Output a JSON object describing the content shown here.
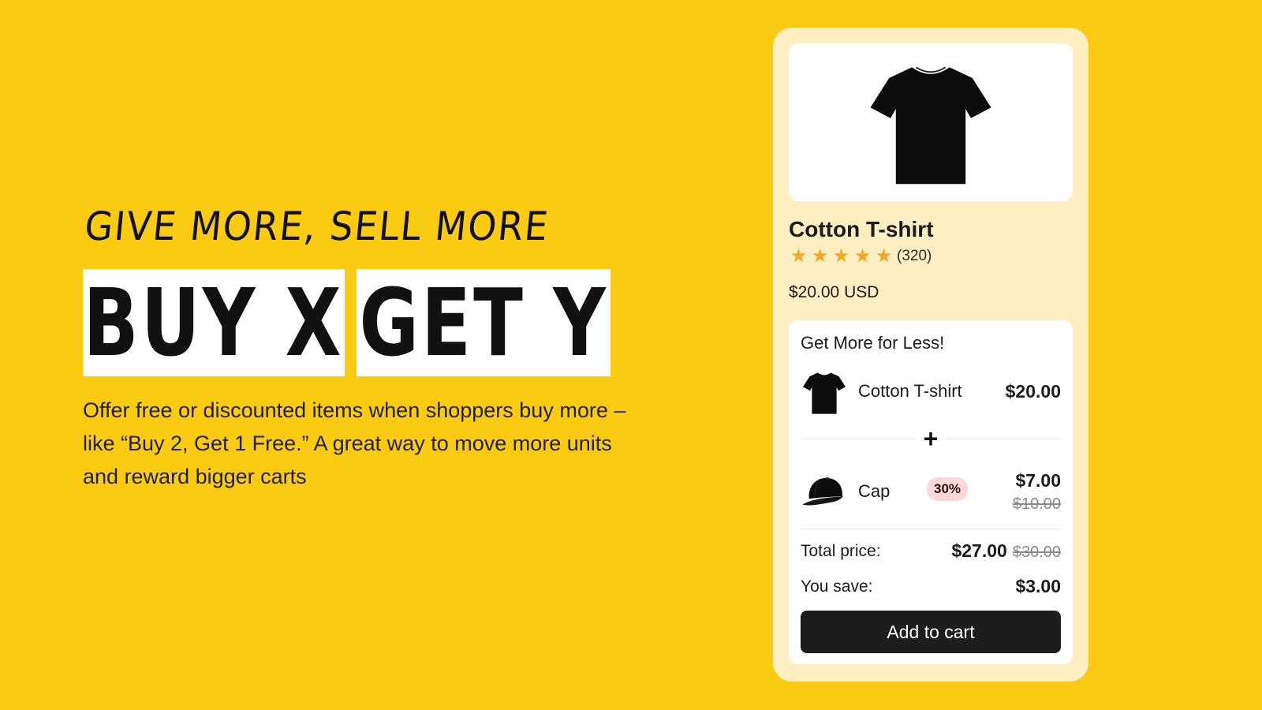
{
  "hero": {
    "tagline": "GIVE MORE, SELL MORE",
    "headline_part1": "BUY X",
    "headline_part2": "GET Y",
    "description": "Offer free or discounted items when shoppers buy more – like “Buy 2, Get 1 Free.” A great way to move more units and reward bigger carts"
  },
  "product": {
    "image_icon": "t-shirt-icon",
    "title": "Cotton T-shirt",
    "rating": 5,
    "review_count": "(320)",
    "price": "$20.00 USD"
  },
  "bundle": {
    "title": "Get More for Less!",
    "items": [
      {
        "icon": "t-shirt-icon",
        "name": "Cotton T-shirt",
        "price": "$20.00"
      },
      {
        "icon": "cap-icon",
        "name": "Cap",
        "discount": "30%",
        "price": "$7.00",
        "original_price": "$10.00"
      }
    ],
    "separator_icon": "plus-icon",
    "total_label": "Total price:",
    "total_price": "$27.00",
    "total_original": "$30.00",
    "save_label": "You save:",
    "save_amount": "$3.00",
    "button_label": "Add to cart"
  },
  "colors": {
    "background": "#FBCB14",
    "card": "#FDEFC2",
    "star": "#F5A623",
    "button": "#1D1D1F",
    "badge": "#FBD9D9"
  }
}
